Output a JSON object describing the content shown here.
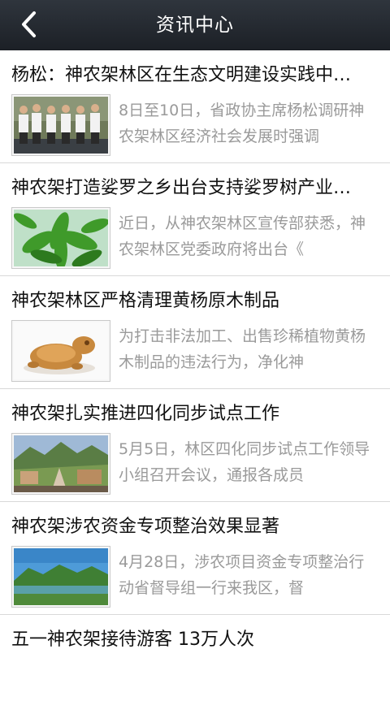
{
  "header": {
    "title": "资讯中心",
    "back_icon": "chevron-left-icon"
  },
  "news": [
    {
      "title": "杨松：神农架林区在生态文明建设实践中…",
      "summary": "8日至10日，省政协主席杨松调研神农架林区经济社会发展时强调",
      "image": "officials-group-photo"
    },
    {
      "title": "神农架打造娑罗之乡出台支持娑罗树产业…",
      "summary": "近日，从神农架林区宣传部获悉，神农架林区党委政府将出台《",
      "image": "green-leaves"
    },
    {
      "title": "神农架林区严格清理黄杨原木制品",
      "summary": "为打击非法加工、出售珍稀植物黄杨木制品的违法行为，净化神",
      "image": "wooden-dragon-turtle-carving"
    },
    {
      "title": "神农架扎实推进四化同步试点工作",
      "summary": "5月5日，林区四化同步试点工作领导小组召开会议，通报各成员",
      "image": "mountain-town-landscape"
    },
    {
      "title": "神农架涉农资金专项整治效果显著",
      "summary": "4月28日，涉农项目资金专项整治行动省督导组一行来我区，督",
      "image": "lake-hills-landscape"
    },
    {
      "title": "五一神农架接待游客 13万人次",
      "summary": "",
      "image": ""
    }
  ]
}
